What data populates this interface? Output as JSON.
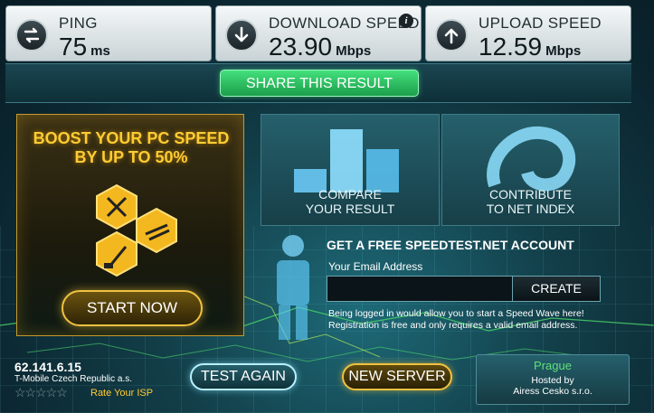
{
  "metrics": [
    {
      "label": "PING",
      "value": "75",
      "unit": "ms",
      "icon": "ping-arrows-icon"
    },
    {
      "label": "DOWNLOAD SPEED",
      "value": "23.90",
      "unit": "Mbps",
      "icon": "download-arrow-icon",
      "info": "i"
    },
    {
      "label": "UPLOAD SPEED",
      "value": "12.59",
      "unit": "Mbps",
      "icon": "upload-arrow-icon"
    }
  ],
  "share_label": "SHARE THIS RESULT",
  "boost": {
    "title_line1": "BOOST YOUR PC SPEED",
    "title_line2": "BY UP TO 50%",
    "start_label": "START NOW"
  },
  "tiles": {
    "compare_line1": "COMPARE",
    "compare_line2": "YOUR RESULT",
    "contribute_line1": "CONTRIBUTE",
    "contribute_line2": "TO NET INDEX"
  },
  "account": {
    "title": "GET A FREE SPEEDTEST.NET ACCOUNT",
    "email_label": "Your Email Address",
    "email_value": "",
    "create_label": "CREATE",
    "note_line1": "Being logged in would allow you to start a Speed Wave here!",
    "note_line2": "Registration is free and only requires a valid email address."
  },
  "isp": {
    "ip": "62.141.6.15",
    "name": "T-Mobile Czech Republic a.s.",
    "stars": "☆☆☆☆☆",
    "rate_label": "Rate Your ISP"
  },
  "buttons": {
    "test_again": "TEST AGAIN",
    "new_server": "NEW SERVER"
  },
  "server": {
    "city": "Prague",
    "hosted_by_label": "Hosted by",
    "host": "Airess Cesko s.r.o."
  },
  "colors": {
    "accent_green": "#2ec766",
    "accent_gold": "#f0c240",
    "panel_teal": "#1e5a66"
  }
}
